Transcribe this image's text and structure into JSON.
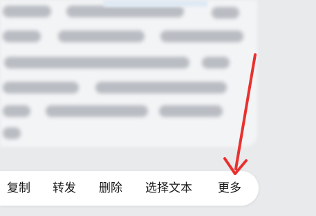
{
  "context_menu": {
    "items": [
      {
        "label": "复制"
      },
      {
        "label": "转发"
      },
      {
        "label": "删除"
      },
      {
        "label": "选择文本"
      },
      {
        "label": "更多"
      }
    ]
  },
  "annotation": {
    "type": "arrow",
    "color": "#e8312f",
    "points_to": "更多"
  }
}
